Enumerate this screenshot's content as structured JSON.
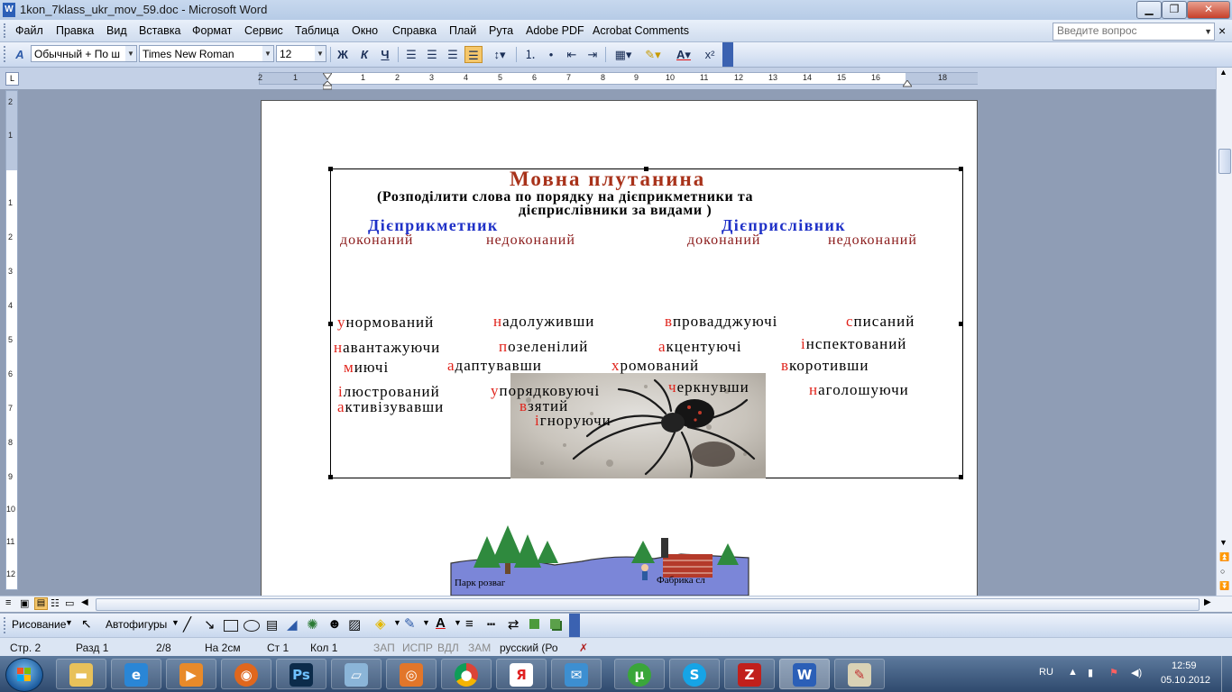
{
  "window": {
    "title": "1kon_7klass_ukr_mov_59.doc - Microsoft Word",
    "minimize": "▁",
    "maximize": "❐",
    "close": "✕"
  },
  "menu": {
    "items": [
      "Файл",
      "Правка",
      "Вид",
      "Вставка",
      "Формат",
      "Сервис",
      "Таблица",
      "Окно",
      "Справка",
      "Плай",
      "Рута",
      "Adobe PDF",
      "Acrobat Comments"
    ],
    "help_placeholder": "Введите вопрос",
    "close_doc": "×"
  },
  "toolbar": {
    "style": "Обычный + По ш",
    "font": "Times New Roman",
    "size": "12",
    "bold": "Ж",
    "italic": "К",
    "underline": "Ч",
    "superscript": "x²"
  },
  "ruler": {
    "h_numbers": [
      "2",
      "1",
      "1",
      "2",
      "3",
      "4",
      "5",
      "6",
      "7",
      "8",
      "9",
      "10",
      "11",
      "12",
      "13",
      "14",
      "15",
      "16",
      "18"
    ],
    "v_numbers": [
      "2",
      "1",
      "1",
      "2",
      "3",
      "4",
      "5",
      "6",
      "7",
      "8",
      "9",
      "10",
      "11",
      "12"
    ],
    "tab_selector": "L"
  },
  "document": {
    "title": "Мовна   плутанина",
    "subtitle_line1": "(Розподілити слова по порядку на дієприкметники та",
    "subtitle_line2": "дієприслівники за видами )",
    "heading_left": "Дієприкметник",
    "heading_right": "Дієприслівник",
    "sub_headers": [
      "доконаний",
      "недоконаний",
      "доконаний",
      "недоконаний"
    ],
    "words": [
      {
        "first": "у",
        "rest": "нормований"
      },
      {
        "first": "н",
        "rest": "адолуживши"
      },
      {
        "first": "в",
        "rest": "провадджуючі"
      },
      {
        "first": "с",
        "rest": "писаний"
      },
      {
        "first": "н",
        "rest": "авантажуючи"
      },
      {
        "first": "п",
        "rest": "озеленілий"
      },
      {
        "first": "а",
        "rest": "кцентуючі"
      },
      {
        "first": "і",
        "rest": "нспектований"
      },
      {
        "first": "м",
        "rest": "иючі"
      },
      {
        "first": "а",
        "rest": "даптувавши"
      },
      {
        "first": "х",
        "rest": "ромований"
      },
      {
        "first": "в",
        "rest": "коротивши"
      },
      {
        "first": "і",
        "rest": "люстрований"
      },
      {
        "first": "у",
        "rest": "порядковуючі"
      },
      {
        "first": "ч",
        "rest": "еркнувши"
      },
      {
        "first": "н",
        "rest": "аголошуючи"
      },
      {
        "first": "а",
        "rest": "ктивізувавши"
      },
      {
        "first": "в",
        "rest": "зятий"
      },
      {
        "first": "і",
        "rest": "гноруючи"
      }
    ],
    "map_label_left": "Парк розваг",
    "map_label_right": "Фабрика сл"
  },
  "drawing_toolbar": {
    "draw": "Рисование",
    "autoshapes": "Автофигуры"
  },
  "status": {
    "page": "Стр. 2",
    "section": "Разд 1",
    "pages": "2/8",
    "at": "На  2см",
    "line": "Ст  1",
    "col": "Кол  1",
    "rec": "ЗАП",
    "trk": "ИСПР",
    "ext": "ВДЛ",
    "ovr": "ЗАМ",
    "language": "русский (Ро"
  },
  "taskbar": {
    "apps": [
      "explorer",
      "internet-explorer",
      "media-player",
      "firefox",
      "photoshop",
      "notes",
      "opera-like",
      "chrome",
      "yandex",
      "mail",
      "utorrent",
      "skype",
      "filezilla",
      "word",
      "paint"
    ],
    "lang": "RU",
    "time": "12:59",
    "date": "05.10.2012"
  },
  "colors": {
    "title_red": "#a8321a",
    "heading_blue": "#1f31c7",
    "subheader_red": "#8b1b1b",
    "first_letter_red": "#e0231b"
  }
}
